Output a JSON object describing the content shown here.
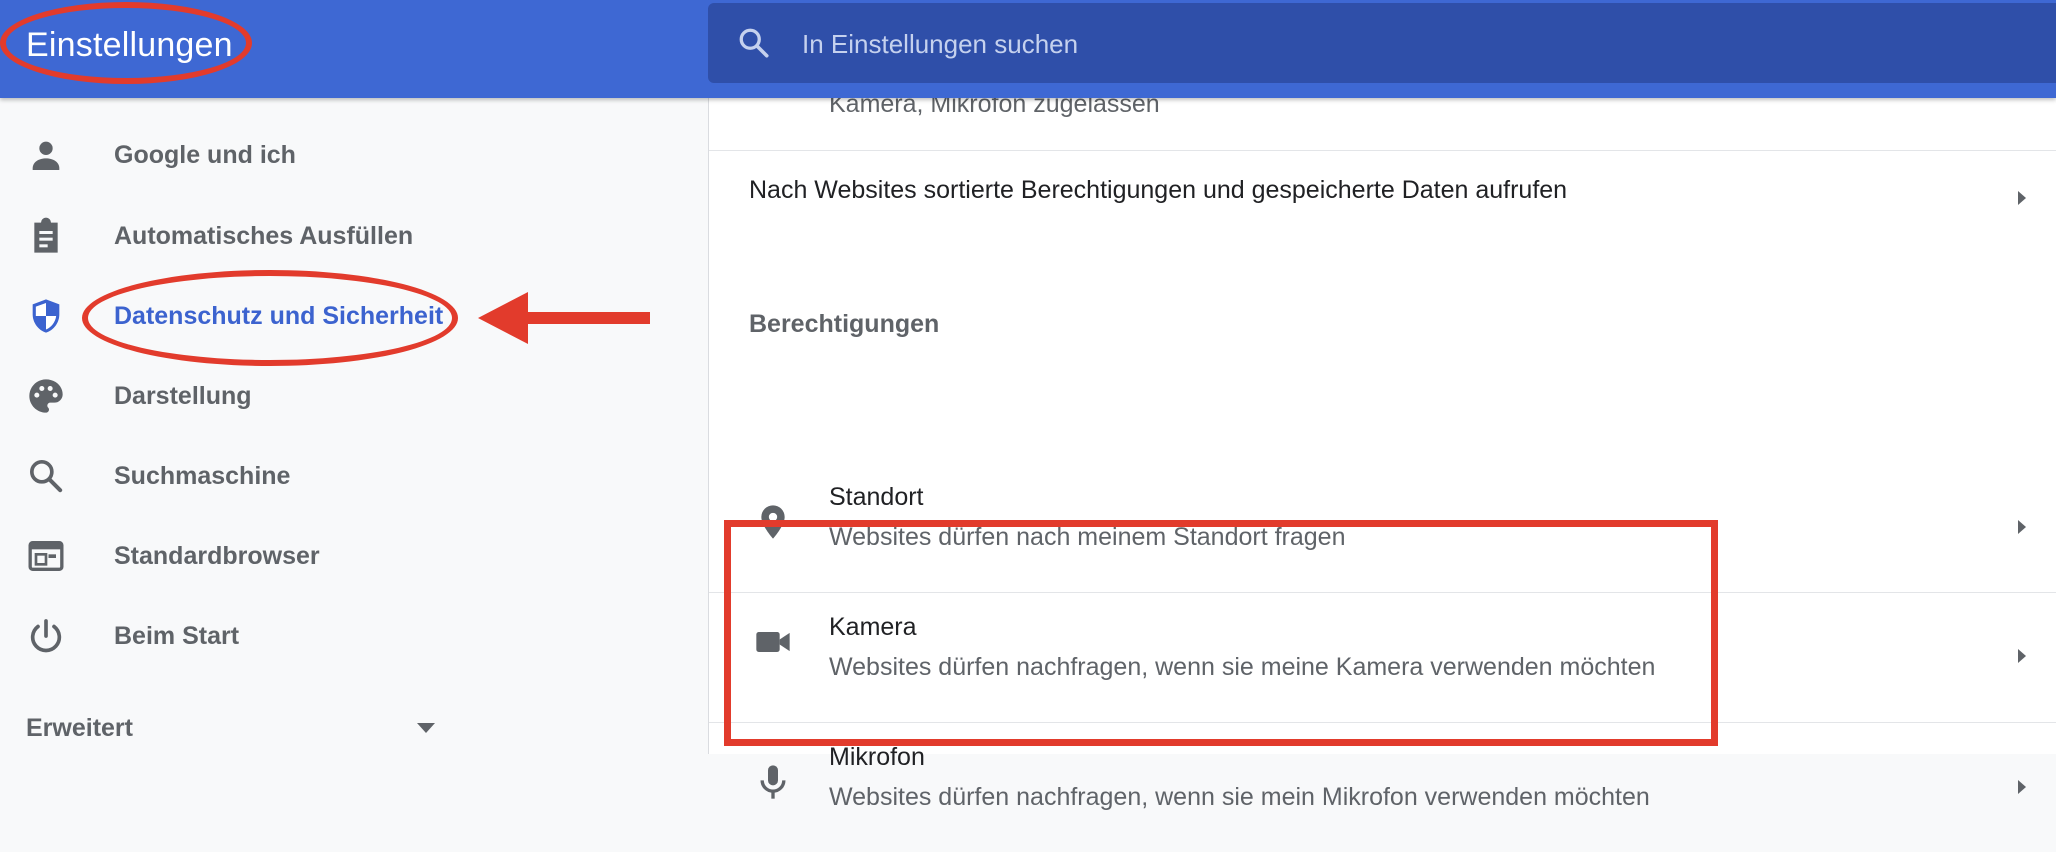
{
  "header": {
    "title": "Einstellungen",
    "search_placeholder": "In Einstellungen suchen",
    "search_icon": "search-icon"
  },
  "sidebar": {
    "items": [
      {
        "label": "Google und ich",
        "icon": "person-icon",
        "active": false
      },
      {
        "label": "Automatisches Ausfüllen",
        "icon": "clipboard-icon",
        "active": false
      },
      {
        "label": "Datenschutz und Sicherheit",
        "icon": "shield-icon",
        "active": true
      },
      {
        "label": "Darstellung",
        "icon": "palette-icon",
        "active": false
      },
      {
        "label": "Suchmaschine",
        "icon": "search-icon",
        "active": false
      },
      {
        "label": "Standardbrowser",
        "icon": "browser-window-icon",
        "active": false
      },
      {
        "label": "Beim Start",
        "icon": "power-icon",
        "active": false
      }
    ],
    "advanced_label": "Erweitert"
  },
  "main": {
    "partial_row_text": "Kamera, Mikrofon zugelassen",
    "site_data_link": "Nach Websites sortierte Berechtigungen und gespeicherte Daten aufrufen",
    "permissions_heading": "Berechtigungen",
    "permissions": [
      {
        "title": "Standort",
        "description": "Websites dürfen nach meinem Standort fragen",
        "icon": "location-pin-icon"
      },
      {
        "title": "Kamera",
        "description": "Websites dürfen nachfragen, wenn sie meine Kamera verwenden möchten",
        "icon": "video-camera-icon"
      },
      {
        "title": "Mikrofon",
        "description": "Websites dürfen nachfragen, wenn sie mein Mikrofon verwenden möchten",
        "icon": "microphone-icon"
      }
    ]
  },
  "colors": {
    "header_bg": "#3e68d3",
    "search_bg": "#2f4fa9",
    "active_nav": "#3c63cf",
    "annotation": "#e23b2c"
  }
}
